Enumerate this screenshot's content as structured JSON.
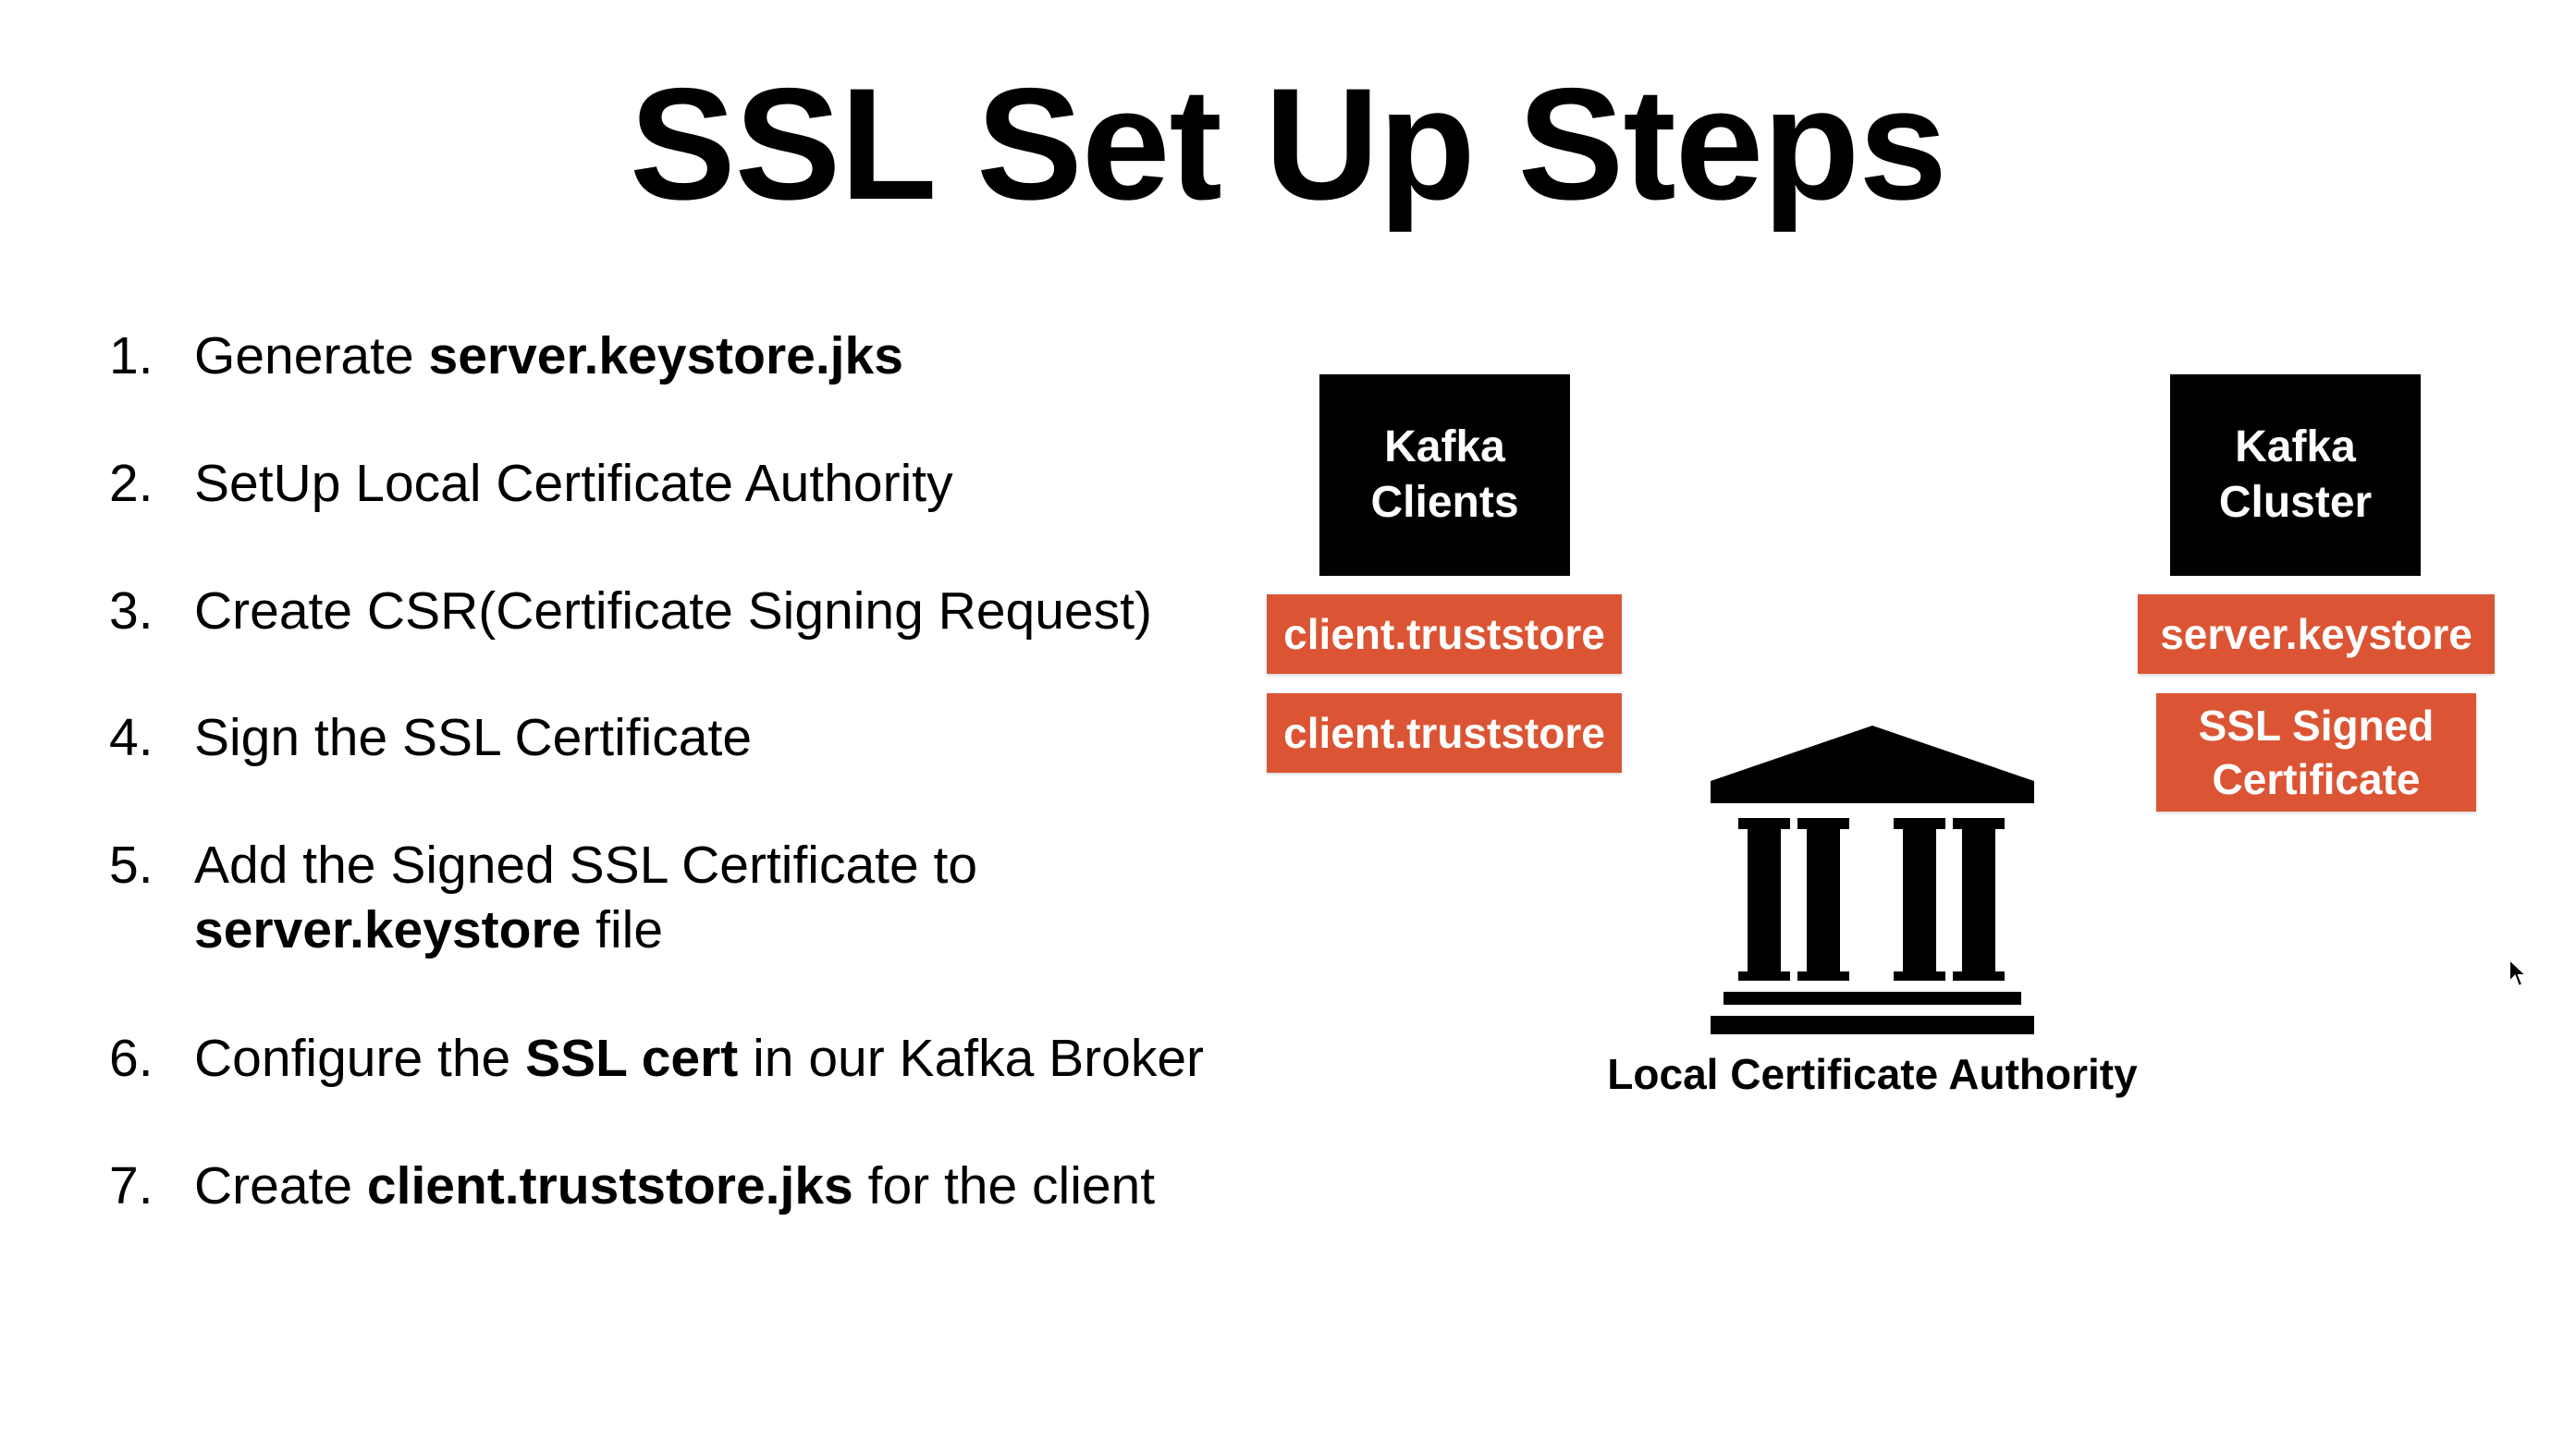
{
  "title": "SSL Set Up Steps",
  "steps": [
    {
      "num": "1.",
      "parts": [
        {
          "text": "Generate ",
          "bold": false
        },
        {
          "text": "server.keystore.jks",
          "bold": true
        }
      ]
    },
    {
      "num": "2.",
      "parts": [
        {
          "text": "SetUp Local Certificate Authority",
          "bold": false
        }
      ]
    },
    {
      "num": "3.",
      "parts": [
        {
          "text": "Create CSR(Certificate Signing Request)",
          "bold": false
        }
      ]
    },
    {
      "num": "4.",
      "parts": [
        {
          "text": "Sign the SSL Certificate",
          "bold": false
        }
      ]
    },
    {
      "num": "5.",
      "line1": "Add the Signed SSL Certificate to",
      "line2_bold": "server.keystore",
      "line2_rest": " file"
    },
    {
      "num": "6.",
      "parts": [
        {
          "text": "Configure the ",
          "bold": false
        },
        {
          "text": "SSL cert",
          "bold": true
        },
        {
          "text": " in our Kafka Broker",
          "bold": false
        }
      ]
    },
    {
      "num": "7.",
      "parts": [
        {
          "text": "Create ",
          "bold": false
        },
        {
          "text": "client.truststore.jks",
          "bold": true
        },
        {
          "text": " for the client",
          "bold": false
        }
      ]
    }
  ],
  "diagram": {
    "clients_box": {
      "line1": "Kafka",
      "line2": "Clients"
    },
    "cluster_box": {
      "line1": "Kafka",
      "line2": "Cluster"
    },
    "client_truststore_1": "client.truststore",
    "client_truststore_2": "client.truststore",
    "server_keystore": "server.keystore",
    "ssl_signed_cert": {
      "line1": "SSL Signed",
      "line2": "Certificate"
    },
    "ca_label": "Local Certificate Authority"
  },
  "colors": {
    "accent_orange": "#db5534",
    "box_black": "#000000",
    "text": "#000000",
    "background": "#ffffff"
  },
  "icons": {
    "authority": "bank-building-icon",
    "cursor": "mouse-pointer-icon"
  }
}
